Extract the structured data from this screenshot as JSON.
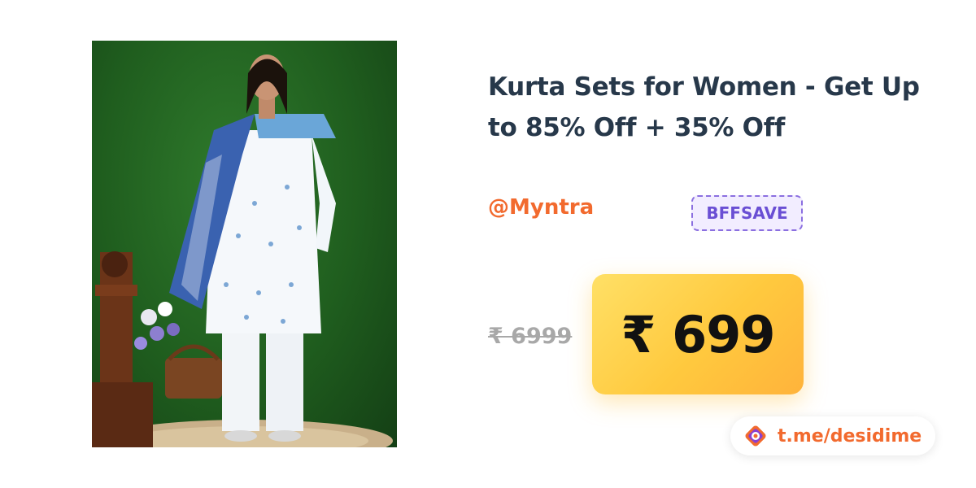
{
  "product": {
    "title": "Kurta Sets for Women - Get Up to 85% Off + 35% Off",
    "image_icon": "product-photo"
  },
  "store": {
    "label": "@Myntra"
  },
  "coupon": {
    "code": "BFFSAVE"
  },
  "pricing": {
    "original": "₹ 6999",
    "deal": "₹ 699"
  },
  "channel": {
    "label": "t.me/desidime",
    "icon": "desidime-logo-icon"
  },
  "colors": {
    "accent_orange": "#f26a2e",
    "coupon_purple": "#6a4fd4",
    "price_yellow": "#ffc93e",
    "title_navy": "#27384a"
  }
}
